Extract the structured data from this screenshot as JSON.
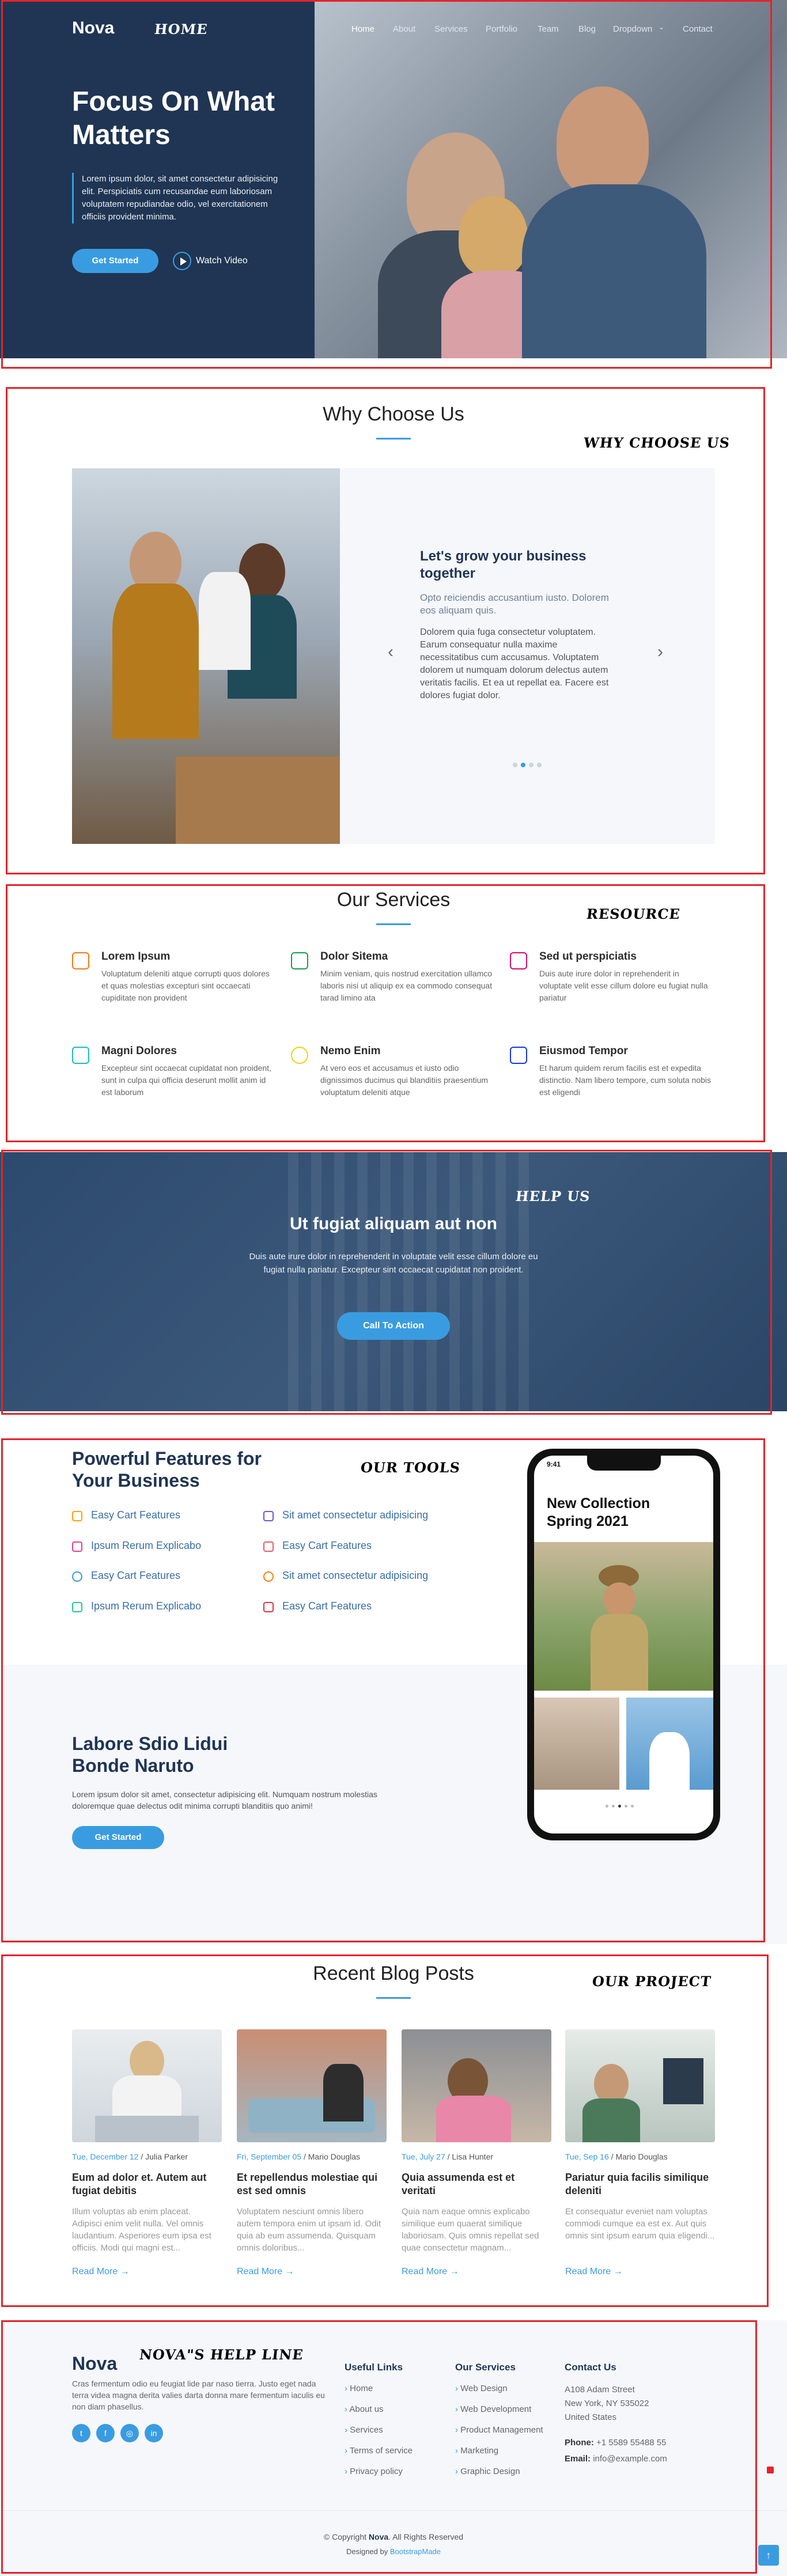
{
  "header": {
    "logo": "Nova",
    "nav": [
      "Home",
      "About",
      "Services",
      "Portfolio",
      "Team",
      "Blog",
      "Dropdown",
      "Contact"
    ]
  },
  "stamps": {
    "home": "HOME",
    "why": "WHY CHOOSE US",
    "resource": "RESOURCE",
    "help": "HELP US",
    "tools": "OUR TOOLS",
    "project": "OUR PROJECT",
    "helpline": "NOVA\"S HELP LINE"
  },
  "hero": {
    "title": "Focus On What Matters",
    "text": "Lorem ipsum dolor, sit amet consectetur adipisicing elit. Perspiciatis cum recusandae eum laboriosam voluptatem repudiandae odio, vel exercitationem officiis provident minima.",
    "cta": "Get Started",
    "video": "Watch Video"
  },
  "why": {
    "title": "Why Choose Us",
    "slide_title": "Let's grow your business together",
    "slide_lead": "Opto reiciendis accusantium iusto. Dolorem eos aliquam quis.",
    "slide_text": "Dolorem quia fuga consectetur voluptatem. Earum consequatur nulla maxime necessitatibus cum accusamus. Voluptatem dolorem ut numquam dolorum delectus autem veritatis facilis. Et ea ut repellat ea. Facere est dolores fugiat dolor."
  },
  "services": {
    "title": "Our Services",
    "items": [
      {
        "title": "Lorem Ipsum",
        "text": "Voluptatum deleniti atque corrupti quos dolores et quas molestias excepturi sint occaecati cupiditate non provident",
        "icon": "briefcase-icon",
        "color": "#f57813"
      },
      {
        "title": "Dolor Sitema",
        "text": "Minim veniam, quis nostrud exercitation ullamco laboris nisi ut aliquip ex ea commodo consequat tarad limino ata",
        "icon": "card-checklist-icon",
        "color": "#15a04a"
      },
      {
        "title": "Sed ut perspiciatis",
        "text": "Duis aute irure dolor in reprehenderit in voluptate velit esse cillum dolore eu fugiat nulla pariatur",
        "icon": "bar-chart-icon",
        "color": "#d90769"
      },
      {
        "title": "Magni Dolores",
        "text": "Excepteur sint occaecat cupidatat non proident, sunt in culpa qui officia deserunt mollit anim id est laborum",
        "icon": "binoculars-icon",
        "color": "#15bfbc"
      },
      {
        "title": "Nemo Enim",
        "text": "At vero eos et accusamus et iusto odio dignissimos ducimus qui blanditiis praesentium voluptatum deleniti atque",
        "icon": "brightness-icon",
        "color": "#f5cf13"
      },
      {
        "title": "Eiusmod Tempor",
        "text": "Et harum quidem rerum facilis est et expedita distinctio. Nam libero tempore, cum soluta nobis est eligendi",
        "icon": "calendar-icon",
        "color": "#1335f5"
      }
    ]
  },
  "cta": {
    "title": "Ut fugiat aliquam aut non",
    "text": "Duis aute irure dolor in reprehenderit in voluptate velit esse cillum dolore eu fugiat nulla pariatur. Excepteur sint occaecat cupidatat non proident.",
    "button": "Call To Action"
  },
  "features": {
    "title": "Powerful Features for Your Business",
    "items": [
      {
        "label": "Easy Cart Features",
        "color": "#ff9f0a"
      },
      {
        "label": "Sit amet consectetur adipisicing",
        "color": "#6a5acd"
      },
      {
        "label": "Ipsum Rerum Explicabo",
        "color": "#e83e8c"
      },
      {
        "label": "Easy Cart Features",
        "color": "#e35d6a"
      },
      {
        "label": "Easy Cart Features",
        "color": "#3a9ce0"
      },
      {
        "label": "Sit amet consectetur adipisicing",
        "color": "#fd7e14"
      },
      {
        "label": "Ipsum Rerum Explicabo",
        "color": "#20c997"
      },
      {
        "label": "Easy Cart Features",
        "color": "#dc3545"
      }
    ],
    "sub_title": "Labore Sdio Lidui Bonde Naruto",
    "sub_text": "Lorem ipsum dolor sit amet, consectetur adipisicing elit. Numquam nostrum molestias doloremque quae delectus odit minima corrupti blanditiis quo animi!",
    "cta": "Get Started",
    "phone": {
      "time": "9:41",
      "heading": "New Collection Spring 2021"
    }
  },
  "blog": {
    "title": "Recent Blog Posts",
    "posts": [
      {
        "date": "Tue, December 12",
        "author": "Julia Parker",
        "title": "Eum ad dolor et. Autem aut fugiat debitis",
        "text": "Illum voluptas ab enim placeat. Adipisci enim velit nulla. Vel omnis laudantium. Asperiores eum ipsa est officiis. Modi qui magni est...",
        "more": "Read More"
      },
      {
        "date": "Fri, September 05",
        "author": "Mario Douglas",
        "title": "Et repellendus molestiae qui est sed omnis",
        "text": "Voluptatem nesciunt omnis libero autem tempora enim ut ipsam id. Odit quia ab eum assumenda. Quisquam omnis doloribus...",
        "more": "Read More"
      },
      {
        "date": "Tue, July 27",
        "author": "Lisa Hunter",
        "title": "Quia assumenda est et veritati",
        "text": "Quia nam eaque omnis explicabo similique eum quaerat similique laboriosam. Quis omnis repellat sed quae consectetur magnam...",
        "more": "Read More"
      },
      {
        "date": "Tue, Sep 16",
        "author": "Mario Douglas",
        "title": "Pariatur quia facilis similique deleniti",
        "text": "Et consequatur eveniet nam voluptas commodi cumque ea est ex. Aut quis omnis sint ipsum earum quia eligendi...",
        "more": "Read More"
      }
    ]
  },
  "footer": {
    "logo": "Nova",
    "about": "Cras fermentum odio eu feugiat lide par naso tierra. Justo eget nada terra videa magna derita valies darta donna mare fermentum iaculis eu non diam phasellus.",
    "useful_title": "Useful Links",
    "useful": [
      "Home",
      "About us",
      "Services",
      "Terms of service",
      "Privacy policy"
    ],
    "services_title": "Our Services",
    "services": [
      "Web Design",
      "Web Development",
      "Product Management",
      "Marketing",
      "Graphic Design"
    ],
    "contact_title": "Contact Us",
    "address1": "A108 Adam Street",
    "address2": "New York, NY 535022",
    "address3": "United States",
    "phone_label": "Phone:",
    "phone": "+1 5589 55488 55",
    "email_label": "Email:",
    "email": "info@example.com",
    "copyright_pre": "© Copyright",
    "copyright_brand": "Nova",
    "copyright_post": ". All Rights Reserved",
    "designed_pre": "Designed by",
    "designed_by": "BootstrapMade"
  }
}
